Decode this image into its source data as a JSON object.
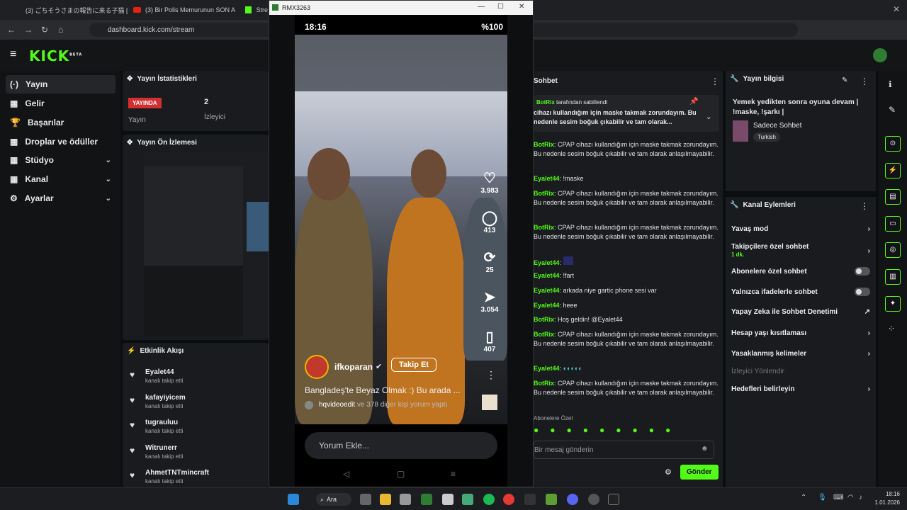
{
  "browser": {
    "tabs": [
      "(3) ごちそうさまの報告に来る子猫 [",
      "(3) Bir Polis Memurunun SON A",
      "Stre"
    ],
    "url": "dashboard.kick.com/stream"
  },
  "kick": {
    "logo": "KICK",
    "beta": "BETA"
  },
  "sidebar": {
    "items": [
      {
        "label": "Yayın",
        "icon": "(·)"
      },
      {
        "label": "Gelir",
        "icon": "▦"
      },
      {
        "label": "Başarılar",
        "icon": "🏆"
      },
      {
        "label": "Droplar ve ödüller",
        "icon": "▦"
      },
      {
        "label": "Stüdyo",
        "icon": "▦"
      },
      {
        "label": "Kanal",
        "icon": "▦"
      },
      {
        "label": "Ayarlar",
        "icon": "⚙"
      }
    ]
  },
  "stats": {
    "title": "Yayın İstatistikleri",
    "live": "YAYINDA",
    "live_label": "Yayın",
    "viewers": "2",
    "viewers_label": "İzleyici"
  },
  "preview": {
    "title": "Yayın Ön İzlemesi"
  },
  "activity": {
    "title": "Etkinlik Akışı",
    "items": [
      {
        "name": "Eyalet44",
        "sub": "kanalı takip etti"
      },
      {
        "name": "kafayiyicem",
        "sub": "kanalı takip etti"
      },
      {
        "name": "tugrauluu",
        "sub": "kanalı takip etti"
      },
      {
        "name": "Witrunerr",
        "sub": "kanalı takip etti"
      },
      {
        "name": "AhmetTNTmincraft",
        "sub": "kanalı takip etti"
      }
    ]
  },
  "phone_window": {
    "title": "RMX3263",
    "time": "18:16",
    "battery": "%100",
    "likes": "3.983",
    "comments": "413",
    "reposts": "25",
    "shares": "3.054",
    "saves": "407",
    "username": "ifkoparan",
    "follow": "Takip Et",
    "caption": "Bangladeş'te Beyaz Olmak :) Bu arada ...",
    "commenters_a": "hqvideoedit",
    "commenters_b": "ve 378 diğer kişi yorum yaptı",
    "comment_placeholder": "Yorum Ekle..."
  },
  "chat": {
    "title": "Sohbet",
    "pinned_by": "BotRix",
    "pinned_by_suffix": "tarafından sabitlendi",
    "pinned_text": "cihazı kullandığım için maske takmak zorundayım. Bu nedenle sesim boğuk çıkabilir ve tam olarak...",
    "messages": [
      {
        "u": "BotRix",
        "t": ": CPAP cihazı kullandığım için maske takmak zorundayım. Bu nedenle sesim boğuk çıkabilir ve tam olarak anlaşılmayabilir."
      },
      {
        "u": "Eyalet44",
        "t": ": !maske"
      },
      {
        "u": "BotRix",
        "t": ": CPAP cihazı kullandığım için maske takmak zorundayım. Bu nedenle sesim boğuk çıkabilir ve tam olarak anlaşılmayabilir."
      },
      {
        "u": "BotRix",
        "t": ": CPAP cihazı kullandığım için maske takmak zorundayım. Bu nedenle sesim boğuk çıkabilir ve tam olarak anlaşılmayabilir."
      },
      {
        "u": "Eyalet44",
        "t": ":"
      },
      {
        "u": "Eyalet44",
        "t": ": !fart"
      },
      {
        "u": "Eyalet44",
        "t": ": arkada niye gartic phone sesi var"
      },
      {
        "u": "Eyalet44",
        "t": ": heee"
      },
      {
        "u": "BotRix",
        "t": ": Hoş geldin! @Eyalet44"
      },
      {
        "u": "BotRix",
        "t": ": CPAP cihazı kullandığım için maske takmak zorundayım. Bu nedenle sesim boğuk çıkabilir ve tam olarak anlaşılmayabilir."
      },
      {
        "u": "Eyalet44",
        "t": ":"
      },
      {
        "u": "BotRix",
        "t": ": CPAP cihazı kullandığım için maske takmak zorundayım. Bu nedenle sesim boğuk çıkabilir ve tam olarak anlaşılmayabilir."
      }
    ],
    "emote_label": "Abonelere Özel",
    "input_placeholder": "Bir mesaj gönderin",
    "send": "Gönder"
  },
  "info": {
    "title": "Yayın bilgisi",
    "stream_title": "Yemek yedikten sonra oyuna devam | !maske, !şarkı |",
    "category": "Sadece Sohbet",
    "tag": "Turkish"
  },
  "actions": {
    "title": "Kanal Eylemleri",
    "items": [
      {
        "label": "Yavaş mod",
        "type": "arrow"
      },
      {
        "label": "Takipçilere özel sohbet",
        "sub": "1 dk.",
        "type": "arrow"
      },
      {
        "label": "Abonelere özel sohbet",
        "type": "toggle"
      },
      {
        "label": "Yalnızca ifadelerle sohbet",
        "type": "toggle"
      },
      {
        "label": "Yapay Zeka ile Sohbet Denetimi",
        "type": "ext"
      },
      {
        "label": "Hesap yaşı kısıtlaması",
        "type": "arrow"
      },
      {
        "label": "Yasaklanmış kelimeler",
        "type": "arrow"
      },
      {
        "label": "İzleyici Yönlendir",
        "type": "disabled"
      },
      {
        "label": "Hedefleri belirleyin",
        "type": "arrow"
      }
    ]
  },
  "taskbar": {
    "search": "Ara",
    "time": "18:16",
    "date": "1.01.2026"
  }
}
